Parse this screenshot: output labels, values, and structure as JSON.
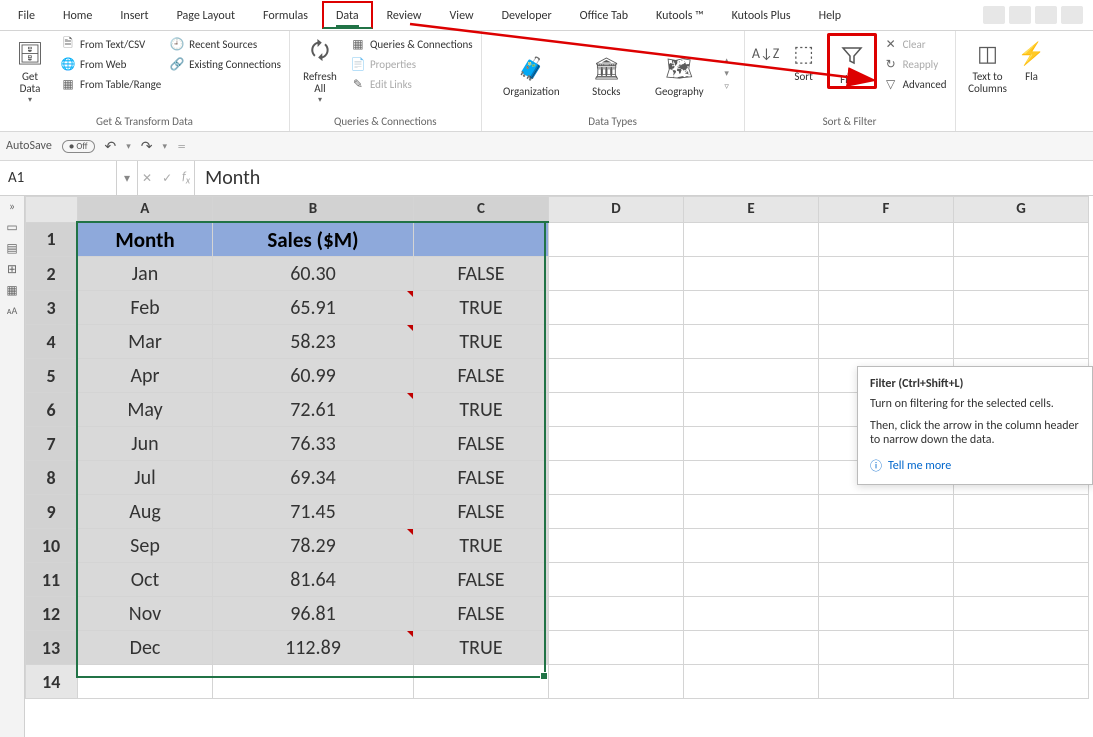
{
  "tabs": {
    "items": [
      "File",
      "Home",
      "Insert",
      "Page Layout",
      "Formulas",
      "Data",
      "Review",
      "View",
      "Developer",
      "Office Tab",
      "Kutools ™",
      "Kutools Plus",
      "Help"
    ],
    "active": "Data"
  },
  "ribbon": {
    "get": {
      "getdata": "Get\nData",
      "txtcsv": "From Text/CSV",
      "web": "From Web",
      "tablerange": "From Table/Range",
      "recent": "Recent Sources",
      "existing": "Existing Connections",
      "group": "Get & Transform Data"
    },
    "queries": {
      "refresh": "Refresh\nAll",
      "qc": "Queries & Connections",
      "prop": "Properties",
      "edit": "Edit Links",
      "group": "Queries & Connections"
    },
    "datatypes": {
      "org": "Organization",
      "stocks": "Stocks",
      "geo": "Geography",
      "group": "Data Types"
    },
    "sortfilter": {
      "sort": "Sort",
      "filter": "Filter",
      "clear": "Clear",
      "reapply": "Reapply",
      "advanced": "Advanced",
      "group": "Sort & Filter"
    },
    "tools": {
      "ttc": "Text to\nColumns",
      "flash": "Fla"
    }
  },
  "qat": {
    "autosave": "AutoSave",
    "off": "Off"
  },
  "formula": {
    "name": "A1",
    "content": "Month"
  },
  "columns": [
    "A",
    "B",
    "C",
    "D",
    "E",
    "F",
    "G"
  ],
  "headers": {
    "A": "Month",
    "B": "Sales ($M)",
    "C": ""
  },
  "rows": [
    {
      "n": 2,
      "A": "Jan",
      "B": "60.30",
      "C": "FALSE",
      "tri": []
    },
    {
      "n": 3,
      "A": "Feb",
      "B": "65.91",
      "C": "TRUE",
      "tri": [
        "B"
      ]
    },
    {
      "n": 4,
      "A": "Mar",
      "B": "58.23",
      "C": "TRUE",
      "tri": [
        "B"
      ]
    },
    {
      "n": 5,
      "A": "Apr",
      "B": "60.99",
      "C": "FALSE",
      "tri": []
    },
    {
      "n": 6,
      "A": "May",
      "B": "72.61",
      "C": "TRUE",
      "tri": [
        "B"
      ]
    },
    {
      "n": 7,
      "A": "Jun",
      "B": "76.33",
      "C": "FALSE",
      "tri": []
    },
    {
      "n": 8,
      "A": "Jul",
      "B": "69.34",
      "C": "FALSE",
      "tri": []
    },
    {
      "n": 9,
      "A": "Aug",
      "B": "71.45",
      "C": "FALSE",
      "tri": []
    },
    {
      "n": 10,
      "A": "Sep",
      "B": "78.29",
      "C": "TRUE",
      "tri": [
        "B"
      ]
    },
    {
      "n": 11,
      "A": "Oct",
      "B": "81.64",
      "C": "FALSE",
      "tri": []
    },
    {
      "n": 12,
      "A": "Nov",
      "B": "96.81",
      "C": "FALSE",
      "tri": []
    },
    {
      "n": 13,
      "A": "Dec",
      "B": "112.89",
      "C": "TRUE",
      "tri": [
        "B"
      ]
    }
  ],
  "extrarow": 14,
  "tooltip": {
    "title": "Filter (Ctrl+Shift+L)",
    "p1": "Turn on filtering for the selected cells.",
    "p2": "Then, click the arrow in the column header to narrow down the data.",
    "link": "Tell me more"
  }
}
